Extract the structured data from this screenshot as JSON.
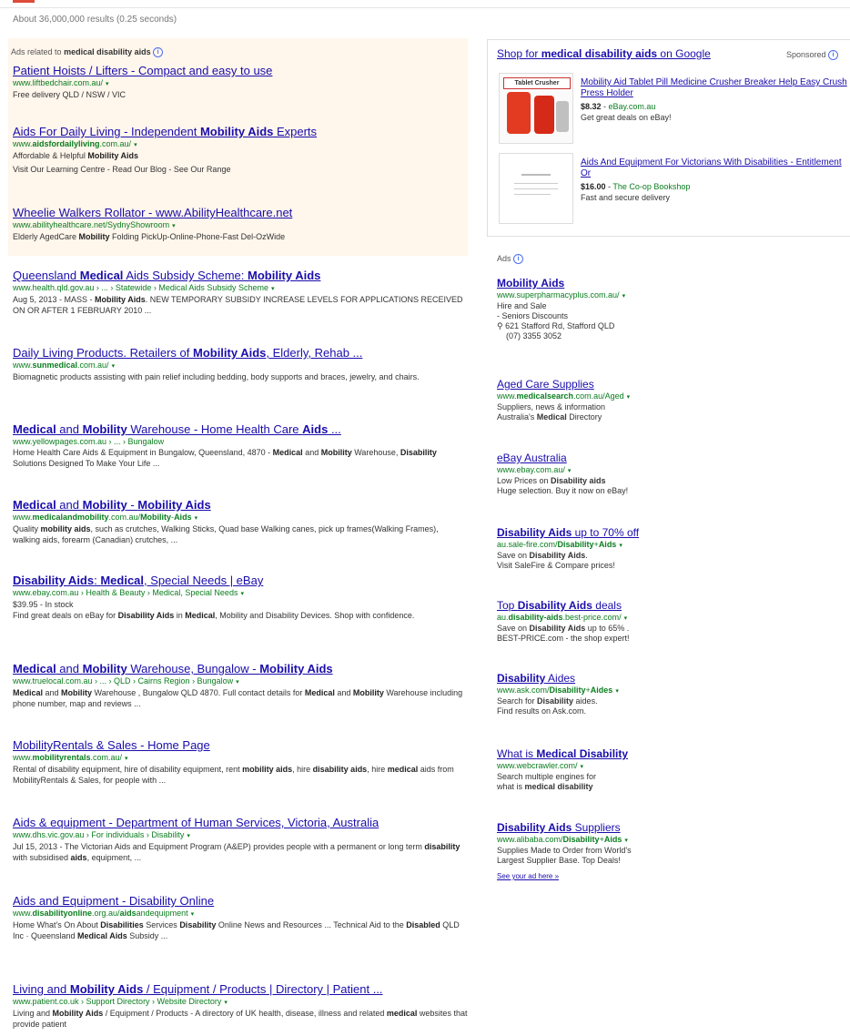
{
  "stats": "About 36,000,000 results (0.25 seconds)",
  "ads_header": {
    "prefix": "Ads related to",
    "query": "medical disability aids",
    "info": "i"
  },
  "top_ads": [
    {
      "title": "Patient Hoists / Lifters - Compact and easy to use",
      "url": "www.liftbedchair.com.au/",
      "desc": "Free delivery QLD / NSW / VIC"
    },
    {
      "title_parts": [
        "Aids For Daily Living - Independent ",
        "Mobility Aids",
        " Experts"
      ],
      "url_parts": [
        "www.",
        "aidsfordailyliving",
        ".com.au/"
      ],
      "desc_parts": [
        "Affordable & Helpful ",
        "Mobility Aids"
      ],
      "sitelinks": "Visit Our Learning Centre - Read Our Blog - See Our Range"
    },
    {
      "title": "Wheelie Walkers Rollator - www.AbilityHealthcare.net",
      "url": "www.abilityhealthcare.net/SydnyShowroom",
      "desc_parts": [
        "Elderly AgedCare ",
        "Mobility",
        " Folding PickUp-Online-Phone-Fast Del-OzWide"
      ]
    }
  ],
  "results": [
    {
      "title_parts": [
        "Queensland ",
        "Medical",
        " Aids Subsidy Scheme: ",
        "Mobility Aids"
      ],
      "url": "www.health.qld.gov.au › ... › Statewide › Medical Aids Subsidy Scheme",
      "desc_parts": [
        "Aug 5, 2013 - MASS - ",
        "Mobility Aids",
        ". NEW TEMPORARY SUBSIDY INCREASE LEVELS FOR APPLICATIONS RECEIVED ON OR AFTER 1 FEBRUARY 2010 ..."
      ]
    },
    {
      "title_parts": [
        "Daily Living Products. Retailers of ",
        "Mobility Aids",
        ", Elderly, Rehab ..."
      ],
      "url_parts": [
        "www.",
        "sunmedical",
        ".com.au/"
      ],
      "desc": "Biomagnetic products assisting with pain relief including bedding, body supports and braces, jewelry, and chairs."
    },
    {
      "title_parts": [
        "Medical",
        " and ",
        "Mobility",
        " Warehouse - Home Health Care ",
        "Aids",
        " ..."
      ],
      "url": "www.yellowpages.com.au › ... › Bungalow",
      "desc_parts": [
        "Home Health Care Aids & Equipment in Bungalow, Queensland, 4870 - ",
        "Medical",
        " and ",
        "Mobility",
        " Warehouse, ",
        "Disability",
        " Solutions Designed To Make Your Life ..."
      ]
    },
    {
      "title_parts": [
        "Medical",
        " and ",
        "Mobility",
        " - ",
        "Mobility Aids"
      ],
      "url_parts": [
        "www.",
        "medicalandmobility",
        ".com.au/",
        "Mobility",
        "-",
        "Aids"
      ],
      "desc_parts": [
        "Quality ",
        "mobility aids",
        ", such as crutches, Walking Sticks, Quad base Walking canes, pick up frames(Walking Frames), walking aids, forearm (Canadian) crutches, ..."
      ]
    },
    {
      "title_parts": [
        "Disability Aids",
        ": ",
        "Medical",
        ", Special Needs | eBay"
      ],
      "url": "www.ebay.com.au › Health & Beauty › Medical, Special Needs",
      "price": "$39.95 - In stock",
      "desc_parts": [
        "Find great deals on eBay for ",
        "Disability Aids",
        " in ",
        "Medical",
        ", Mobility and Disability Devices. Shop with confidence."
      ]
    },
    {
      "title_parts": [
        "Medical",
        " and ",
        "Mobility",
        " Warehouse, Bungalow - ",
        "Mobility Aids"
      ],
      "url": "www.truelocal.com.au › ... › QLD › Cairns Region › Bungalow",
      "desc_parts": [
        "Medical",
        " and ",
        "Mobility",
        " Warehouse , Bungalow QLD 4870. Full contact details for ",
        "Medical",
        " and ",
        "Mobility",
        " Warehouse including phone number, map and reviews ..."
      ]
    },
    {
      "title": "MobilityRentals & Sales - Home Page",
      "url_parts": [
        "www.",
        "mobilityrentals",
        ".com.au/"
      ],
      "desc_parts": [
        "Rental of disability equipment, hire of disability equipment, rent ",
        "mobility aids",
        ", hire ",
        "disability aids",
        ", hire ",
        "medical",
        " aids from MobilityRentals & Sales, for people with ..."
      ]
    },
    {
      "title": "Aids & equipment - Department of Human Services, Victoria, Australia",
      "url": "www.dhs.vic.gov.au › For individuals › Disability",
      "desc_parts": [
        "Jul 15, 2013 - The Victorian Aids and Equipment Program (A&EP) provides people with a permanent or long term ",
        "disability",
        " with subsidised ",
        "aids",
        ", equipment, ..."
      ]
    },
    {
      "title_parts": [
        "Aids",
        " and Equipment - ",
        "Disability",
        " Online"
      ],
      "url_parts": [
        "www.",
        "disabilityonline",
        ".org.au/",
        "aids",
        "andequipment"
      ],
      "desc_parts": [
        "Home What's On About ",
        "Disabilities",
        " Services ",
        "Disability",
        " Online News and Resources ... Technical Aid to the ",
        "Disabled",
        " QLD Inc · Queensland ",
        "Medical Aids",
        " Subsidy ..."
      ]
    },
    {
      "title_parts": [
        "Living and ",
        "Mobility Aids",
        " / Equipment / Products | Directory | Patient ..."
      ],
      "url": "www.patient.co.uk › Support Directory › Website Directory",
      "desc_parts": [
        "Living and ",
        "Mobility Aids",
        " / Equipment / Products - A directory of UK health, disease, illness and related ",
        "medical",
        " websites that provide patient"
      ]
    }
  ],
  "shopping": {
    "title_parts": [
      "Shop for ",
      "medical disability aids",
      " on Google"
    ],
    "sponsored": "Sponsored",
    "products": [
      {
        "title": "Mobility Aid Tablet Pill Medicine Crusher Breaker Help Easy Crush Press Holder",
        "price": "$8.32",
        "seller": "eBay.com.au",
        "desc": "Get great deals on eBay!",
        "image_label": "Tablet Crusher"
      },
      {
        "title": "Aids And Equipment For Victorians With Disabilities - Entitlement Or",
        "price": "$16.00",
        "seller": "The Co-op Bookshop",
        "desc": "Fast and secure delivery"
      }
    ]
  },
  "right_ads_header": "Ads",
  "right_ads": [
    {
      "title": "Mobility Aids",
      "url": "www.superpharmacyplus.com.au/",
      "lines": [
        "Hire and Sale",
        "- Seniors Discounts"
      ],
      "address": "621 Stafford Rd, Stafford QLD",
      "phone": "(07) 3355 3052"
    },
    {
      "title": "Aged Care Supplies",
      "url_parts": [
        "www.",
        "medicalsearch",
        ".com.au/Aged"
      ],
      "lines": [
        "Suppliers, news & information"
      ],
      "line2_parts": [
        "Australia's ",
        "Medical",
        " Directory"
      ]
    },
    {
      "title": "eBay Australia",
      "url": "www.ebay.com.au/",
      "line1_parts": [
        "Low Prices on ",
        "Disability aids"
      ],
      "line2": "Huge selection. Buy it now on eBay!"
    },
    {
      "title_parts": [
        "Disability Aids",
        " up to 70% off"
      ],
      "url_parts": [
        "au.sale-fire.com/",
        "Disability",
        "+",
        "Aids"
      ],
      "line1_parts": [
        "Save on ",
        "Disability Aids",
        "."
      ],
      "line2": "Visit SaleFire & Compare prices!"
    },
    {
      "title_parts": [
        "Top ",
        "Disability Aids",
        " deals"
      ],
      "url_parts": [
        "au.",
        "disability-aids",
        ".best-price.com/"
      ],
      "line1_parts": [
        "Save on ",
        "Disability Aids",
        " up to 65% ."
      ],
      "line2": "BEST-PRICE.com - the shop expert!"
    },
    {
      "title_parts": [
        "Disability",
        " Aides"
      ],
      "url_parts": [
        "www.ask.com/",
        "Disability",
        "+",
        "Aides"
      ],
      "line1_parts": [
        "Search for ",
        "Disability",
        " aides."
      ],
      "line2": "Find results on Ask.com."
    },
    {
      "title_parts": [
        "What is ",
        "Medical Disability"
      ],
      "url": "www.webcrawler.com/",
      "line1": "Search multiple engines for",
      "line2_parts": [
        "what is ",
        "medical disability"
      ]
    },
    {
      "title_parts": [
        "Disability Aids",
        " Suppliers"
      ],
      "url_parts": [
        "www.alibaba.com/",
        "Disability",
        "+",
        "Aids"
      ],
      "line1": "Supplies Made to Order from World's",
      "line2": "Largest Supplier Base. Top Deals!"
    }
  ],
  "see_your_ad": "See your ad here »",
  "arrow": "▾",
  "pin": "⚲"
}
